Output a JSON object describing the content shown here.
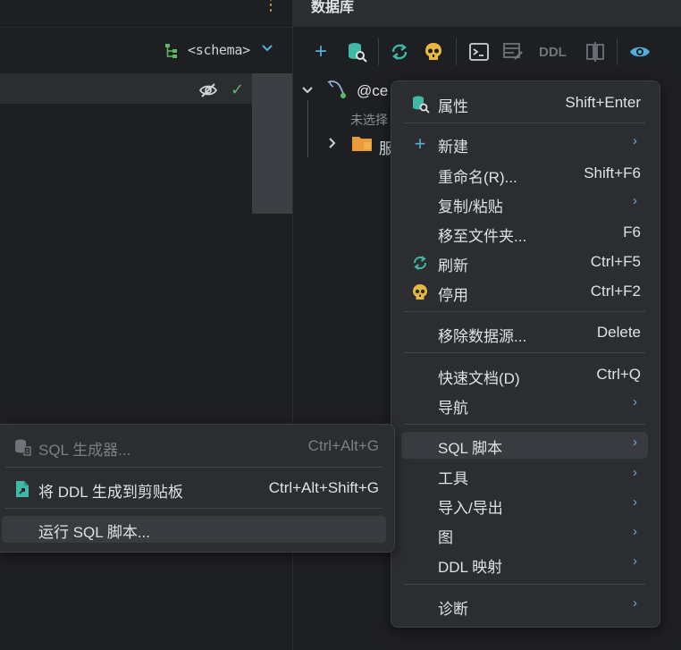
{
  "left_pane": {
    "schema_label": "<schema>"
  },
  "db_pane": {
    "title": "数据库",
    "toolbar": {
      "ddl_label": "DDL"
    },
    "tree": {
      "datasource_label": "@ce",
      "sub_label": "未选择",
      "folder_label": "服"
    }
  },
  "context_menu": {
    "items": [
      {
        "label": "属性",
        "shortcut": "Shift+Enter",
        "icon": "datasource-properties-icon"
      },
      {
        "label": "新建",
        "shortcut": "",
        "icon": "plus-icon",
        "submenu": true
      },
      {
        "label": "重命名(R)...",
        "shortcut": "Shift+F6"
      },
      {
        "label": "复制/粘贴",
        "shortcut": "",
        "submenu": true
      },
      {
        "label": "移至文件夹...",
        "shortcut": "F6"
      },
      {
        "label": "刷新",
        "shortcut": "Ctrl+F5",
        "icon": "refresh-icon"
      },
      {
        "label": "停用",
        "shortcut": "Ctrl+F2",
        "icon": "skull-icon"
      },
      {
        "label": "移除数据源...",
        "shortcut": "Delete"
      },
      {
        "label": "快速文档(D)",
        "shortcut": "Ctrl+Q"
      },
      {
        "label": "导航",
        "shortcut": "",
        "submenu": true
      },
      {
        "label": "SQL 脚本",
        "shortcut": "",
        "submenu": true,
        "highlighted": true
      },
      {
        "label": "工具",
        "shortcut": "",
        "submenu": true
      },
      {
        "label": "导入/导出",
        "shortcut": "",
        "submenu": true
      },
      {
        "label": "图",
        "shortcut": "",
        "submenu": true
      },
      {
        "label": "DDL 映射",
        "shortcut": "",
        "submenu": true
      },
      {
        "label": "诊断",
        "shortcut": "",
        "submenu": true
      }
    ],
    "arrow": "›"
  },
  "sql_submenu": {
    "items": [
      {
        "label": "SQL 生成器...",
        "shortcut": "Ctrl+Alt+G",
        "disabled": true,
        "icon": "sql-generator-icon"
      },
      {
        "label": "将 DDL 生成到剪贴板",
        "shortcut": "Ctrl+Alt+Shift+G",
        "icon": "ddl-clipboard-icon"
      },
      {
        "label": "运行 SQL 脚本...",
        "shortcut": "",
        "highlighted": true
      }
    ]
  },
  "colors": {
    "background": "#1e1f22",
    "menu_bg": "#2b2d30",
    "highlight": "#393b40",
    "accent_blue": "#4fb0e0",
    "teal": "#3fb8a6",
    "yellow": "#e8b73f",
    "green": "#5fb865"
  }
}
